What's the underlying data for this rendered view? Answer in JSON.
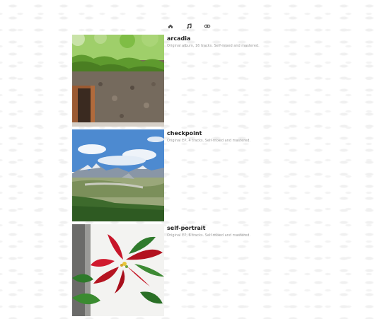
{
  "nav": {
    "items": [
      {
        "icon": "home-icon"
      },
      {
        "icon": "music-note-icon"
      },
      {
        "icon": "link-icon"
      }
    ],
    "icon_color": "#555555"
  },
  "releases": [
    {
      "title": "arcadia",
      "description": "Original album, 16 tracks. Self-mixed and mastered.",
      "cover": "stone-hut-photo"
    },
    {
      "title": "checkpoint",
      "description": "Original EP, 4 tracks. Self-mixed and mastered.",
      "cover": "mountain-valley-photo"
    },
    {
      "title": "self-portrait",
      "description": "Original EP, 6 tracks. Self-mixed and mastered.",
      "cover": "poinsettia-photo"
    }
  ]
}
